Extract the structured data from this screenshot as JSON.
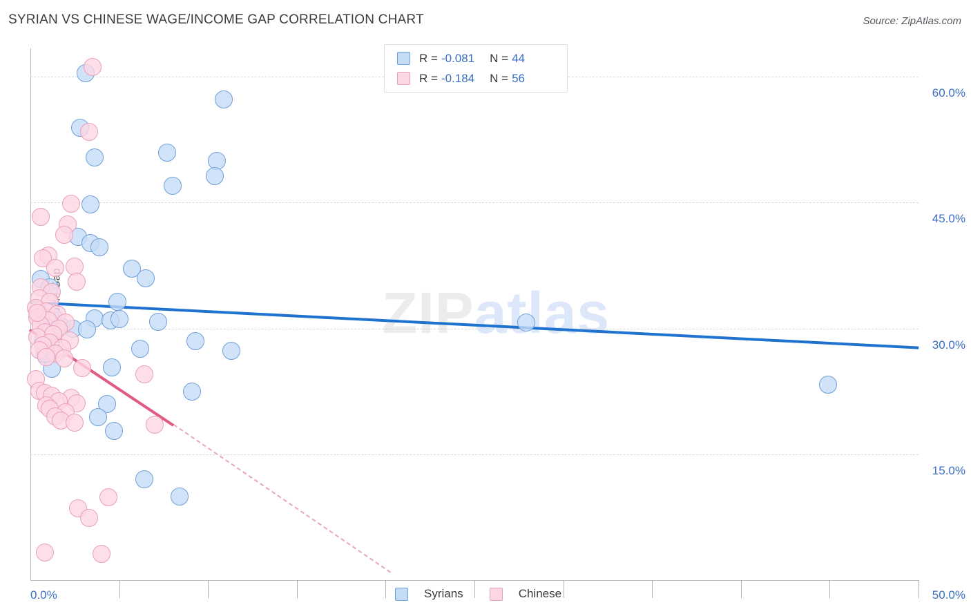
{
  "header": {
    "title": "SYRIAN VS CHINESE WAGE/INCOME GAP CORRELATION CHART",
    "source": "Source: ZipAtlas.com"
  },
  "watermark": {
    "part1": "ZIP",
    "part2": "atlas"
  },
  "stats": {
    "rows": [
      {
        "series": "Syrians",
        "r_label": "R =",
        "r_value": "-0.081",
        "n_label": "N =",
        "n_value": "44",
        "color": "#c5dcf5"
      },
      {
        "series": "Chinese",
        "r_label": "R =",
        "r_value": "-0.184",
        "n_label": "N =",
        "n_value": "56",
        "color": "#fcd6e3"
      }
    ]
  },
  "legend": {
    "items": [
      {
        "label": "Syrians",
        "color": "#c5dcf5"
      },
      {
        "label": "Chinese",
        "color": "#fcd6e3"
      }
    ]
  },
  "chart_data": {
    "type": "scatter",
    "title": "SYRIAN VS CHINESE WAGE/INCOME GAP CORRELATION CHART",
    "xlabel": "",
    "ylabel": "Wage/Income Gap",
    "xlim": [
      0.0,
      50.0
    ],
    "ylim": [
      0.0,
      63.4
    ],
    "x_ticks": [
      0.0,
      50.0
    ],
    "x_tick_labels": [
      "0.0%",
      "50.0%"
    ],
    "y_ticks": [
      15.0,
      30.0,
      45.0,
      60.0
    ],
    "y_tick_labels": [
      "15.0%",
      "30.0%",
      "45.0%",
      "60.0%"
    ],
    "grid": "horizontal-dashed",
    "legend_position": "bottom-center",
    "series": [
      {
        "name": "Syrians",
        "color": "#c5dcf5",
        "border_color": "#6f9fd8",
        "r": -0.081,
        "n": 44,
        "trendline": {
          "x0": 0.0,
          "y0": 33.3,
          "x1": 50.0,
          "y1": 27.9,
          "style": "solid"
        },
        "points": [
          [
            3.1,
            60.4
          ],
          [
            10.9,
            57.3
          ],
          [
            2.8,
            53.9
          ],
          [
            3.6,
            50.4
          ],
          [
            7.7,
            51.0
          ],
          [
            10.5,
            50.0
          ],
          [
            10.4,
            48.2
          ],
          [
            8.0,
            47.0
          ],
          [
            3.4,
            44.8
          ],
          [
            2.7,
            40.9
          ],
          [
            3.4,
            40.2
          ],
          [
            3.9,
            39.7
          ],
          [
            5.7,
            37.1
          ],
          [
            6.5,
            36.0
          ],
          [
            0.6,
            35.9
          ],
          [
            1.1,
            34.9
          ],
          [
            4.9,
            33.2
          ],
          [
            0.5,
            32.0
          ],
          [
            1.3,
            31.4
          ],
          [
            3.6,
            31.2
          ],
          [
            4.5,
            31.0
          ],
          [
            5.0,
            31.1
          ],
          [
            7.2,
            30.8
          ],
          [
            27.9,
            30.7
          ],
          [
            1.7,
            30.3
          ],
          [
            2.4,
            30.0
          ],
          [
            3.2,
            29.9
          ],
          [
            0.9,
            29.2
          ],
          [
            9.3,
            28.5
          ],
          [
            0.7,
            28.4
          ],
          [
            1.1,
            27.6
          ],
          [
            6.2,
            27.6
          ],
          [
            11.3,
            27.3
          ],
          [
            0.8,
            26.9
          ],
          [
            4.6,
            25.4
          ],
          [
            1.2,
            25.2
          ],
          [
            9.1,
            22.5
          ],
          [
            4.3,
            21.0
          ],
          [
            3.8,
            19.4
          ],
          [
            4.7,
            17.8
          ],
          [
            44.9,
            23.3
          ],
          [
            6.4,
            12.0
          ],
          [
            8.4,
            10.0
          ],
          [
            0.9,
            27.0
          ]
        ]
      },
      {
        "name": "Chinese",
        "color": "#fcd6e3",
        "border_color": "#e8a0b9",
        "r": -0.184,
        "n": 56,
        "trendline": {
          "x0": 0.0,
          "y0": 30.0,
          "x1": 8.1,
          "y1": 18.6,
          "style": "solid"
        },
        "trendline_extension": {
          "x0": 8.1,
          "y0": 18.6,
          "x1": 20.3,
          "y1": 1.0,
          "style": "dashed"
        },
        "points": [
          [
            3.5,
            61.2
          ],
          [
            3.3,
            53.4
          ],
          [
            2.3,
            44.9
          ],
          [
            0.6,
            43.3
          ],
          [
            2.1,
            42.4
          ],
          [
            1.9,
            41.2
          ],
          [
            1.0,
            38.7
          ],
          [
            0.7,
            38.4
          ],
          [
            2.5,
            37.4
          ],
          [
            1.4,
            37.2
          ],
          [
            2.6,
            35.6
          ],
          [
            0.6,
            34.9
          ],
          [
            1.2,
            34.3
          ],
          [
            0.5,
            33.6
          ],
          [
            1.1,
            33.2
          ],
          [
            0.3,
            32.4
          ],
          [
            0.9,
            32.0
          ],
          [
            1.5,
            31.7
          ],
          [
            0.4,
            31.3
          ],
          [
            1.0,
            31.0
          ],
          [
            2.0,
            30.7
          ],
          [
            0.6,
            30.4
          ],
          [
            1.6,
            30.0
          ],
          [
            0.8,
            29.6
          ],
          [
            1.3,
            29.3
          ],
          [
            0.4,
            29.0
          ],
          [
            2.2,
            28.6
          ],
          [
            1.1,
            28.3
          ],
          [
            0.7,
            28.0
          ],
          [
            1.8,
            27.7
          ],
          [
            0.5,
            27.4
          ],
          [
            1.4,
            27.0
          ],
          [
            0.9,
            26.6
          ],
          [
            2.9,
            25.3
          ],
          [
            6.4,
            24.5
          ],
          [
            0.3,
            24.0
          ],
          [
            0.5,
            22.6
          ],
          [
            0.8,
            22.3
          ],
          [
            1.2,
            22.0
          ],
          [
            2.3,
            21.7
          ],
          [
            1.6,
            21.3
          ],
          [
            2.6,
            21.1
          ],
          [
            0.9,
            20.8
          ],
          [
            1.1,
            20.4
          ],
          [
            2.0,
            20.0
          ],
          [
            1.4,
            19.5
          ],
          [
            1.7,
            19.0
          ],
          [
            2.5,
            18.8
          ],
          [
            7.0,
            18.5
          ],
          [
            4.4,
            9.9
          ],
          [
            2.7,
            8.6
          ],
          [
            3.3,
            7.4
          ],
          [
            0.8,
            3.3
          ],
          [
            4.0,
            3.1
          ],
          [
            0.4,
            31.9
          ],
          [
            1.9,
            26.4
          ]
        ]
      }
    ]
  }
}
